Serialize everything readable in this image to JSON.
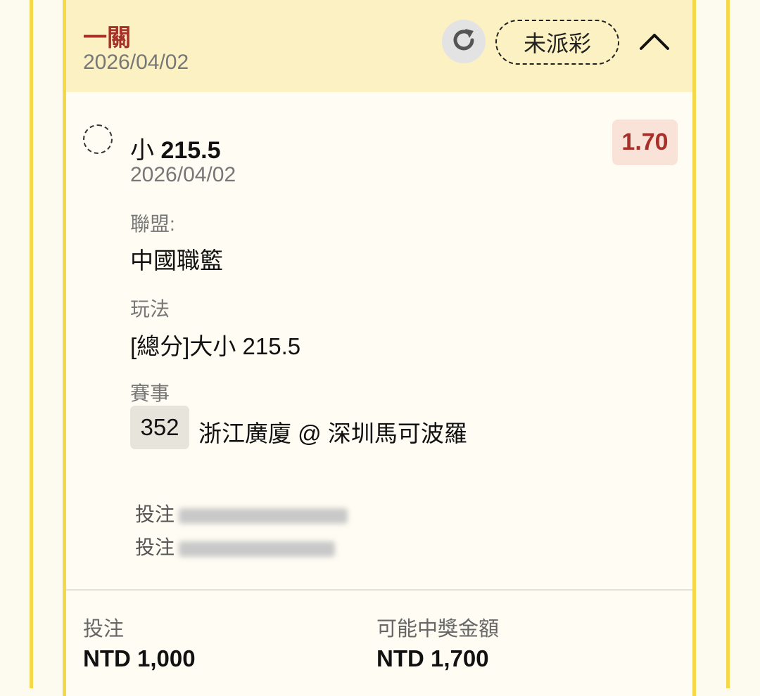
{
  "header": {
    "title": "一關",
    "date": "2026/04/02",
    "status_label": "未派彩"
  },
  "selection": {
    "name": "小",
    "line": "215.5",
    "odds": "1.70",
    "date": "2026/04/02"
  },
  "details": {
    "league_label": "聯盟:",
    "league_value": "中國職籃",
    "bet_type_label": "玩法",
    "bet_type_value": "[總分]大小 215.5",
    "event_label": "賽事",
    "match_number": "352",
    "match_name": "浙江廣廈 @ 深圳馬可波羅",
    "bet_time_label": "投注",
    "bet_id_label": "投注"
  },
  "footer": {
    "stake_label": "投注",
    "stake_value": "NTD 1,000",
    "payout_label": "可能中獎金額",
    "payout_value": "NTD 1,700"
  },
  "icons": {
    "refresh": "refresh-icon",
    "collapse": "chevron-up-icon"
  },
  "colors": {
    "accent_red": "#a8302a",
    "header_bg": "#fcf1c2",
    "border_yellow": "#f3d84a"
  }
}
